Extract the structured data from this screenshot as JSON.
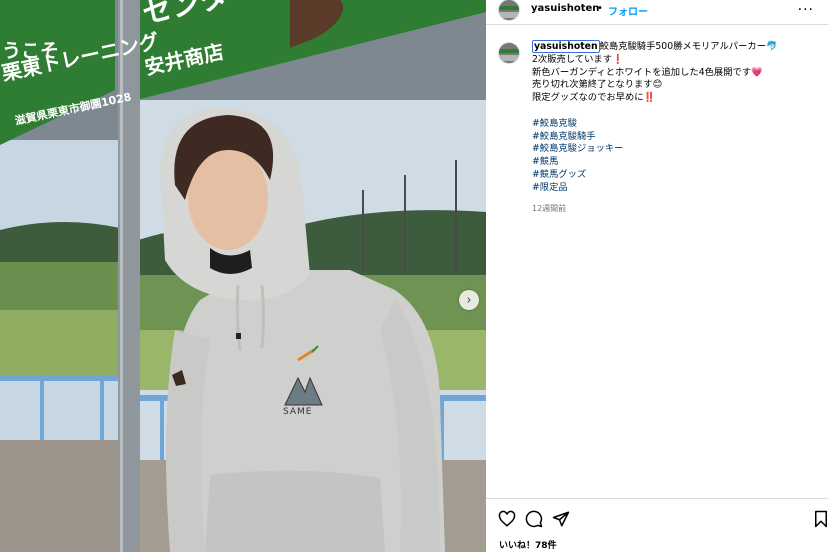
{
  "post": {
    "username": "yasuishoten",
    "dot": "•",
    "follow_label": "フォロー",
    "more_label": "···",
    "caption": {
      "username": "yasuishoten",
      "lines": [
        "鮫島克駿騎手500勝メモリアルパーカー🐬",
        "2次販売しています❗",
        "新色バーガンディとホワイトを追加した4色展開です💗",
        "売り切れ次第終了となります😊",
        "限定グッズなのでお早めに‼️"
      ],
      "hashtags": [
        "#鮫島克駿",
        "#鮫島克駿騎手",
        "#鮫島克駿ジョッキー",
        "#競馬",
        "#競馬グッズ",
        "#限定品"
      ]
    },
    "time_ago": "12週間前",
    "likes": "いいね！78件"
  },
  "photo": {
    "poster_text": [
      "うこそ",
      "栗東トレーニング",
      "滋賀県栗東市御園1028",
      "センター",
      "安井商店"
    ],
    "hoodie_print": "SAME",
    "next_button": "›"
  },
  "colors": {
    "brand_link": "#0095f6",
    "hashtag": "#00376b",
    "poster_green": "#2f7d32",
    "hoodie_grey": "#cfd0cd"
  },
  "icons": [
    "heart-icon",
    "comment-icon",
    "share-icon",
    "bookmark-icon",
    "chevron-right-icon"
  ]
}
